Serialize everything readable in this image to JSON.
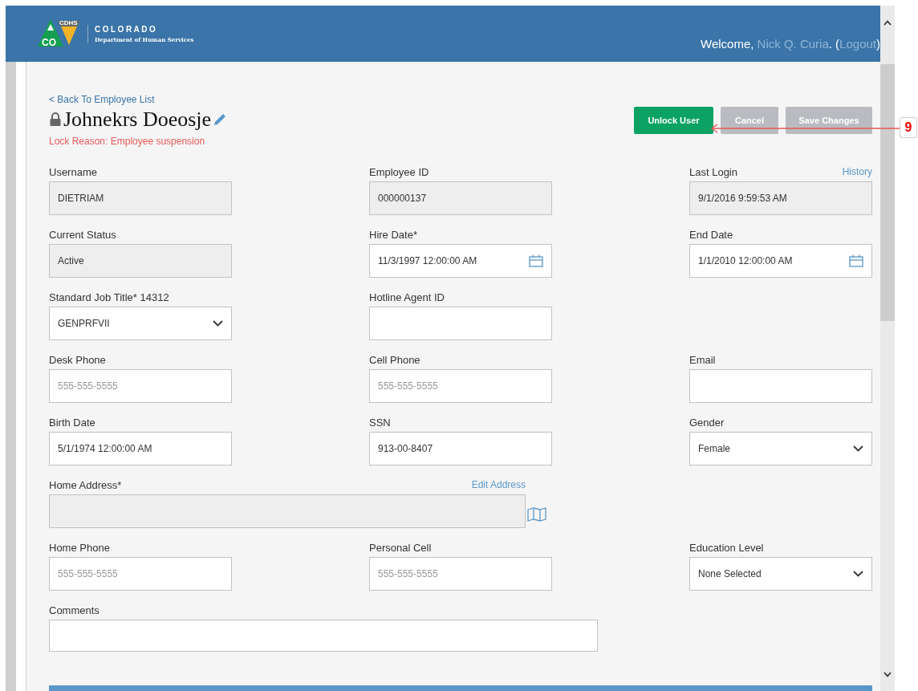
{
  "header": {
    "logo_badge": "CDHS",
    "logo_state": "CO",
    "brand": "COLORADO",
    "subtitle": "Department of Human Services",
    "welcome": "Welcome,",
    "user": "Nick Q. Curia",
    "separator": ". (",
    "logout": "Logout",
    "closing": ")"
  },
  "back_link": "< Back To Employee List",
  "employee": {
    "name": "Johnekrs Doeosje",
    "locked": true,
    "lock_reason": "Lock Reason: Employee suspension"
  },
  "buttons": [
    {
      "label": "Unlock User",
      "kind": "primary",
      "disabled": false
    },
    {
      "label": "Cancel",
      "kind": "secondary",
      "disabled": true
    },
    {
      "label": "Save Changes",
      "kind": "secondary",
      "disabled": true
    }
  ],
  "form_rows": [
    [
      {
        "label": "Username",
        "kind": "readonly",
        "value": "DIETRIAM"
      },
      {
        "label": "Employee ID",
        "kind": "readonly",
        "value": "000000137"
      },
      {
        "label": "Last Login",
        "kind": "readonly",
        "value": "9/1/2016 9:59:53 AM",
        "link": "History"
      }
    ],
    [
      {
        "label": "Current Status",
        "kind": "readonly",
        "value": "Active"
      },
      {
        "label": "Hire Date*",
        "kind": "date",
        "value": "11/3/1997 12:00:00 AM"
      },
      {
        "label": "End Date",
        "kind": "date",
        "value": "1/1/2010 12:00:00 AM"
      }
    ],
    [
      {
        "label": "Standard Job Title* 14312",
        "kind": "select",
        "value": "GENPRFVII"
      },
      {
        "label": "Hotline Agent ID",
        "kind": "text"
      },
      {
        "kind": "empty"
      }
    ],
    [
      {
        "label": "Desk Phone",
        "kind": "text",
        "placeholder": "555-555-5555"
      },
      {
        "label": "Cell Phone",
        "kind": "text",
        "placeholder": "555-555-5555"
      },
      {
        "label": "Email",
        "kind": "text"
      }
    ],
    [
      {
        "label": "Birth Date",
        "kind": "text",
        "value": "5/1/1974 12:00:00 AM"
      },
      {
        "label": "SSN",
        "kind": "text",
        "value": "913-00-8407"
      },
      {
        "label": "Gender",
        "kind": "select",
        "value": "Female"
      }
    ],
    [
      {
        "label": "Home Address*",
        "kind": "address",
        "link": "Edit Address"
      }
    ],
    [
      {
        "label": "Home Phone",
        "kind": "text",
        "placeholder": "555-555-5555"
      },
      {
        "label": "Personal Cell",
        "kind": "text",
        "placeholder": "555-555-5555"
      },
      {
        "label": "Education Level",
        "kind": "select",
        "value": "None Selected"
      }
    ],
    [
      {
        "label": "Comments",
        "kind": "textarea"
      }
    ]
  ],
  "callout": {
    "label": "9"
  }
}
